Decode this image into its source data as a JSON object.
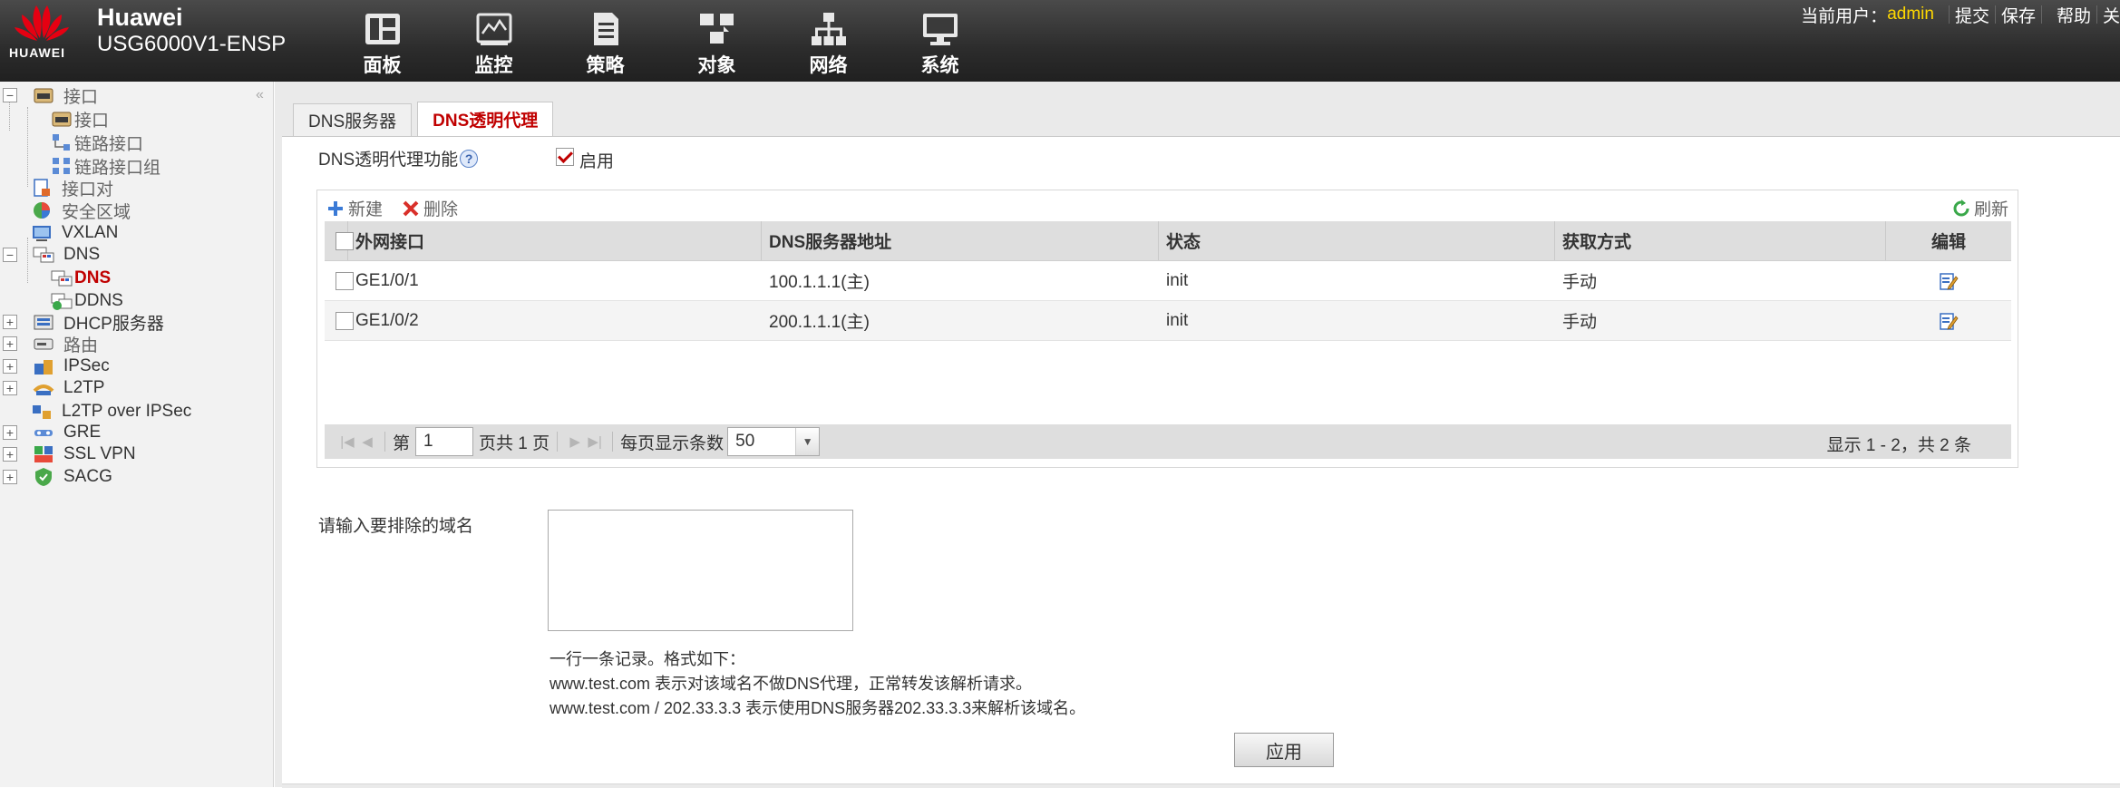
{
  "header": {
    "brand": "Huawei",
    "logo_text": "HUAWEI",
    "device": "USG6000V1-ENSP",
    "nav": [
      {
        "label": "面板",
        "icon": "dashboard-icon"
      },
      {
        "label": "监控",
        "icon": "monitor-icon"
      },
      {
        "label": "策略",
        "icon": "policy-icon"
      },
      {
        "label": "对象",
        "icon": "object-icon"
      },
      {
        "label": "网络",
        "icon": "network-icon"
      },
      {
        "label": "系统",
        "icon": "system-icon"
      }
    ],
    "user_prefix": "当前用户：",
    "user": "admin",
    "links": [
      "提交",
      "保存",
      "帮助",
      "关"
    ]
  },
  "sidebar": {
    "items": [
      {
        "label": "接口",
        "icon": "interface-icon",
        "expander": "−"
      },
      {
        "label": "接口",
        "icon": "interface-icon"
      },
      {
        "label": "链路接口",
        "icon": "link-interface-icon"
      },
      {
        "label": "链路接口组",
        "icon": "link-group-icon"
      },
      {
        "label": "接口对",
        "icon": "interface-pair-icon"
      },
      {
        "label": "安全区域",
        "icon": "security-zone-icon"
      },
      {
        "label": "VXLAN",
        "icon": "vxlan-icon"
      },
      {
        "label": "DNS",
        "icon": "dns-icon",
        "expander": "−"
      },
      {
        "label": "DNS",
        "icon": "dns-icon"
      },
      {
        "label": "DDNS",
        "icon": "ddns-icon"
      },
      {
        "label": "DHCP服务器",
        "icon": "dhcp-icon",
        "expander": "+"
      },
      {
        "label": "路由",
        "icon": "route-icon",
        "expander": "+"
      },
      {
        "label": "IPSec",
        "icon": "ipsec-icon",
        "expander": "+"
      },
      {
        "label": "L2TP",
        "icon": "l2tp-icon",
        "expander": "+"
      },
      {
        "label": "L2TP over IPSec",
        "icon": "l2tp-ipsec-icon"
      },
      {
        "label": "GRE",
        "icon": "gre-icon",
        "expander": "+"
      },
      {
        "label": "SSL VPN",
        "icon": "ssl-vpn-icon",
        "expander": "+"
      },
      {
        "label": "SACG",
        "icon": "sacg-icon",
        "expander": "+"
      }
    ],
    "selected": "DNS"
  },
  "tabs": [
    {
      "label": "DNS服务器",
      "active": false
    },
    {
      "label": "DNS透明代理",
      "active": true
    }
  ],
  "form": {
    "feature_label": "DNS透明代理功能",
    "help": "?",
    "enable_label": "启用",
    "enable_checked": true
  },
  "toolbar": {
    "new_label": "新建",
    "delete_label": "删除",
    "refresh_label": "刷新"
  },
  "table": {
    "columns": [
      "外网接口",
      "DNS服务器地址",
      "状态",
      "获取方式",
      "编辑"
    ],
    "rows": [
      {
        "interface": "GE1/0/1",
        "dns": "100.1.1.1(主)",
        "status": "init",
        "mode": "手动"
      },
      {
        "interface": "GE1/0/2",
        "dns": "200.1.1.1(主)",
        "status": "init",
        "mode": "手动"
      }
    ]
  },
  "pager": {
    "page_prefix": "第",
    "page": "1",
    "page_suffix": "页共 1 页",
    "per_page_label": "每页显示条数",
    "per_page": "50",
    "info": "显示 1 - 2，共 2 条"
  },
  "exclude": {
    "label": "请输入要排除的域名",
    "value": "",
    "hints": [
      "一行一条记录。格式如下：",
      "www.test.com 表示对该域名不做DNS代理，正常转发该解析请求。",
      "www.test.com / 202.33.3.3 表示使用DNS服务器202.33.3.3来解析该域名。"
    ]
  },
  "apply_label": "应用",
  "colors": {
    "accent_red": "#c00000",
    "header_bg": "#2c2c2c",
    "user_yellow": "#ffd800"
  }
}
